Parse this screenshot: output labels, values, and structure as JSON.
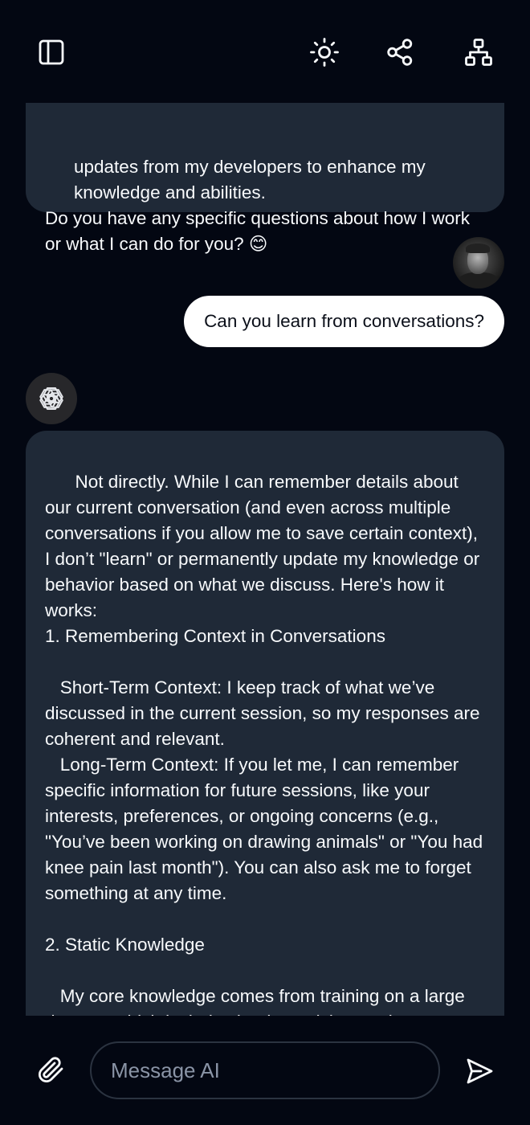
{
  "header": {
    "sidebar_toggle_icon": "sidebar-panel-icon",
    "theme_toggle_icon": "sun-icon",
    "share_icon": "share-icon",
    "sitemap_icon": "sitemap-icon"
  },
  "messages": {
    "previous_ai": {
      "line_1": "updates from my developers to enhance my",
      "line_2": "knowledge and abilities.",
      "line_3": "Do you have any specific questions about how I work or what I can do for you? 😊"
    },
    "user": {
      "avatar_icon": "user-avatar",
      "text": "Can you learn from conversations?"
    },
    "ai": {
      "avatar_icon": "openai-logo-icon",
      "text": "Not directly. While I can remember details about our current conversation (and even across multiple conversations if you allow me to save certain context), I don’t \"learn\" or permanently update my knowledge or behavior based on what we discuss. Here's how it works:\n1. Remembering Context in Conversations\n\n   Short-Term Context: I keep track of what we’ve discussed in the current session, so my responses are coherent and relevant.\n   Long-Term Context: If you let me, I can remember specific information for future sessions, like your interests, preferences, or ongoing concerns (e.g., \"You’ve been working on drawing animals\" or \"You had knee pain last month\"). You can also ask me to forget something at any time.\n\n2. Static Knowledge\n\n   My core knowledge comes from training on a large dataset, which includes books, articles, and"
    }
  },
  "composer": {
    "placeholder": "Message AI",
    "value": "",
    "attach_icon": "paperclip-icon",
    "send_icon": "send-icon"
  }
}
